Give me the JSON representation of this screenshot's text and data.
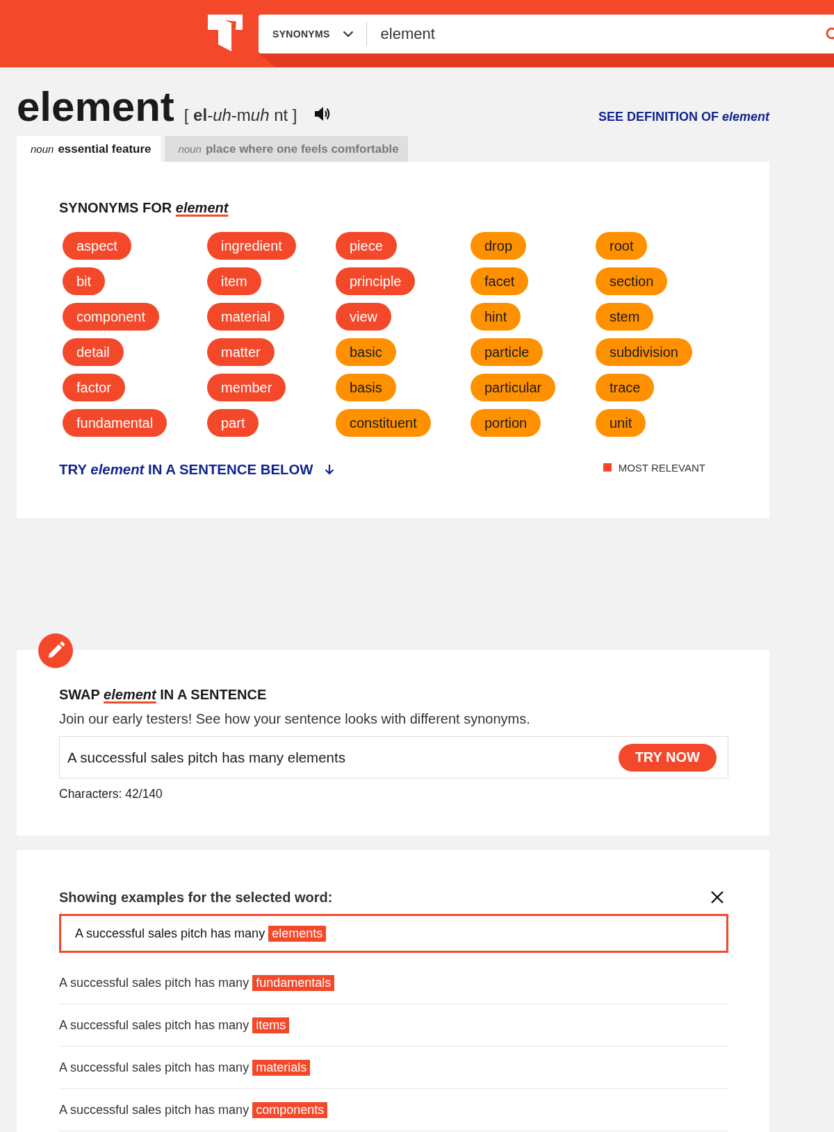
{
  "search": {
    "mode": "SYNONYMS",
    "value": "element"
  },
  "entry": {
    "word": "element",
    "pronunciation": [
      {
        "text": "[ ",
        "kind": "plain"
      },
      {
        "text": "el",
        "kind": "stressed"
      },
      {
        "text": "-",
        "kind": "plain"
      },
      {
        "text": "uh",
        "kind": "reduced"
      },
      {
        "text": "-m",
        "kind": "plain"
      },
      {
        "text": "uh",
        "kind": "reduced"
      },
      {
        "text": " nt ]",
        "kind": "plain"
      }
    ],
    "definition_link": "SEE DEFINITION OF *element*"
  },
  "tabs": [
    {
      "pos": "noun",
      "label": "essential feature",
      "selected": true
    },
    {
      "pos": "noun",
      "label": "place where one feels comfortable",
      "selected": false
    }
  ],
  "synonyms": {
    "heading": {
      "before": "SYNONYMS FOR",
      "word": "element"
    },
    "items": [
      {
        "word": "aspect",
        "color": "#f4482a"
      },
      {
        "word": "bit",
        "color": "#f4482a"
      },
      {
        "word": "component",
        "color": "#f4482a"
      },
      {
        "word": "detail",
        "color": "#f4482a"
      },
      {
        "word": "factor",
        "color": "#f4482a"
      },
      {
        "word": "fundamental",
        "color": "#f4482a"
      },
      {
        "word": "ingredient",
        "color": "#f4482a"
      },
      {
        "word": "item",
        "color": "#f4482a"
      },
      {
        "word": "material",
        "color": "#f4482a"
      },
      {
        "word": "matter",
        "color": "#f4482a"
      },
      {
        "word": "member",
        "color": "#f4482a"
      },
      {
        "word": "part",
        "color": "#f4482a"
      },
      {
        "word": "piece",
        "color": "#f4482a"
      },
      {
        "word": "principle",
        "color": "#f4482a"
      },
      {
        "word": "view",
        "color": "#f4482a"
      },
      {
        "word": "basic",
        "color": "#ff9100"
      },
      {
        "word": "basis",
        "color": "#ff9100"
      },
      {
        "word": "constituent",
        "color": "#ff9100"
      },
      {
        "word": "drop",
        "color": "#ff9100"
      },
      {
        "word": "facet",
        "color": "#ff9100"
      },
      {
        "word": "hint",
        "color": "#ff9100"
      },
      {
        "word": "particle",
        "color": "#ff9100"
      },
      {
        "word": "particular",
        "color": "#ff9100"
      },
      {
        "word": "portion",
        "color": "#ff9100"
      },
      {
        "word": "root",
        "color": "#ff9100"
      },
      {
        "word": "section",
        "color": "#ff9100"
      },
      {
        "word": "stem",
        "color": "#ff9100"
      },
      {
        "word": "subdivision",
        "color": "#ff9100"
      },
      {
        "word": "trace",
        "color": "#ff9100"
      },
      {
        "word": "unit",
        "color": "#ff9100"
      }
    ],
    "try_link": "TRY *element* IN A SENTENCE BELOW",
    "legend": {
      "label": "MOST RELEVANT",
      "color": "#f4482a"
    }
  },
  "swap": {
    "heading": {
      "before": "SWAP",
      "word": "element",
      "after": "IN A SENTENCE"
    },
    "intro": "Join our early testers! See how your sentence looks with different synonyms.",
    "sentence": {
      "value": "A successful sales pitch has many elements"
    },
    "button": "TRY NOW",
    "counter": "Characters: 42/140"
  },
  "examples": {
    "heading": "Showing examples for the selected word:",
    "items": [
      {
        "text": "A successful sales pitch has many",
        "word": "elements",
        "selected": true
      },
      {
        "text": "A successful sales pitch has many",
        "word": "fundamentals",
        "selected": false
      },
      {
        "text": "A successful sales pitch has many",
        "word": "items",
        "selected": false
      },
      {
        "text": "A successful sales pitch has many",
        "word": "materials",
        "selected": false
      },
      {
        "text": "A successful sales pitch has many",
        "word": "components",
        "selected": false
      }
    ]
  }
}
